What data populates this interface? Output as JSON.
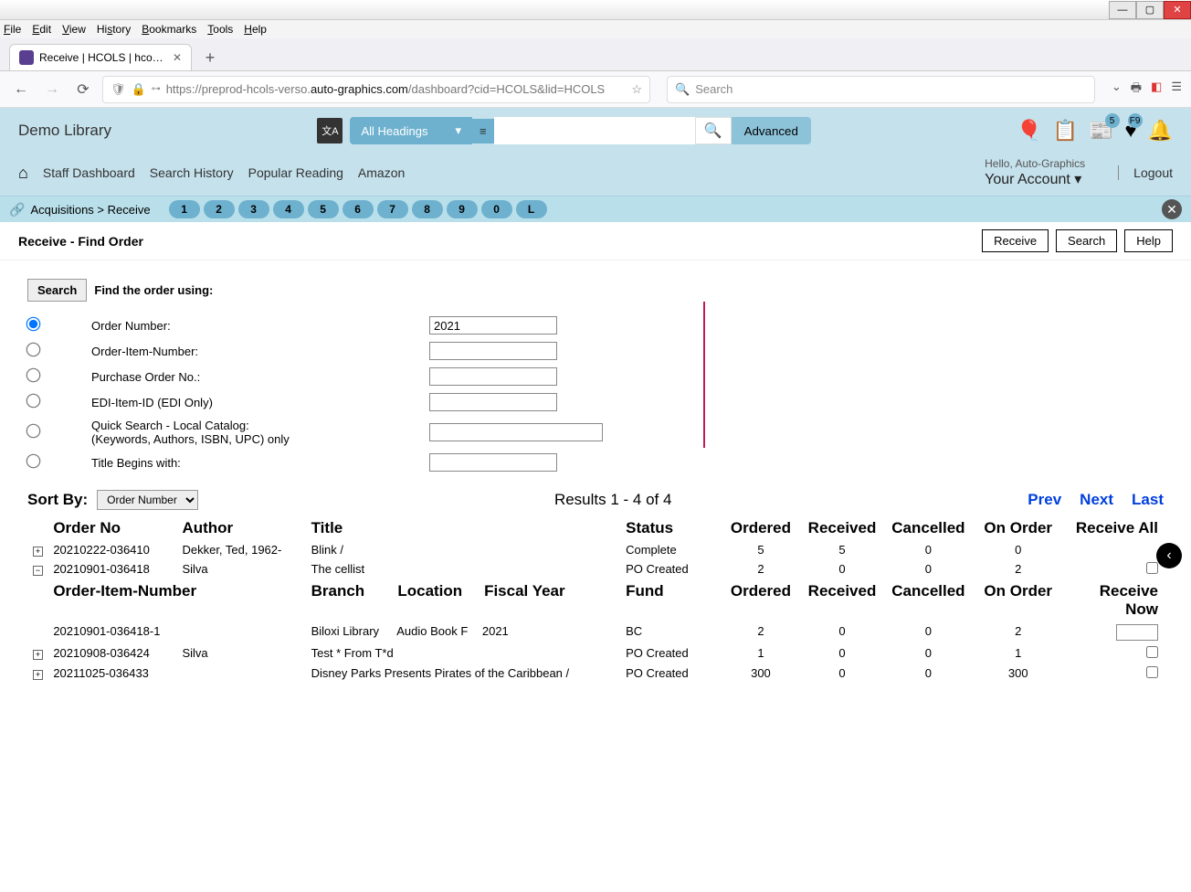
{
  "browser": {
    "menus": [
      "File",
      "Edit",
      "View",
      "History",
      "Bookmarks",
      "Tools",
      "Help"
    ],
    "tab_title": "Receive | HCOLS | hcols | Auto-",
    "url_prefix": "https://preprod-hcols-verso.",
    "url_domain": "auto-graphics.com",
    "url_path": "/dashboard?cid=HCOLS&lid=HCOLS",
    "search_placeholder": "Search"
  },
  "header": {
    "library_name": "Demo Library",
    "headings_label": "All Headings",
    "advanced_label": "Advanced",
    "news_badge": "5",
    "fav_badge": "F9",
    "hello_text": "Hello, Auto-Graphics",
    "account_text": "Your Account",
    "logout_text": "Logout",
    "nav_items": [
      "Staff Dashboard",
      "Search History",
      "Popular Reading",
      "Amazon"
    ]
  },
  "crumbs": {
    "path": "Acquisitions > Receive",
    "pills": [
      "1",
      "2",
      "3",
      "4",
      "5",
      "6",
      "7",
      "8",
      "9",
      "0",
      "L"
    ]
  },
  "page": {
    "title": "Receive - Find Order",
    "actions": {
      "receive": "Receive",
      "search": "Search",
      "help": "Help"
    },
    "search_btn": "Search",
    "instr": "Find the order using:",
    "radios": {
      "order_number": "Order Number:",
      "order_item_number": "Order-Item-Number:",
      "po_number": "Purchase Order No.:",
      "edi_item": "EDI-Item-ID (EDI Only)",
      "quick_search_line1": "Quick Search - Local Catalog:",
      "quick_search_line2": "(Keywords, Authors, ISBN, UPC) only",
      "title_begins": "Title Begins with:"
    },
    "order_number_value": "2021"
  },
  "results": {
    "sort_label": "Sort By:",
    "sort_value": "Order Number",
    "count_text": "Results 1 - 4 of 4",
    "pager": {
      "prev": "Prev",
      "next": "Next",
      "last": "Last"
    },
    "main_headers": [
      "Order No",
      "Author",
      "Title",
      "Status",
      "Ordered",
      "Received",
      "Cancelled",
      "On Order",
      "Receive All"
    ],
    "rows": [
      {
        "order": "20210222-036410",
        "author": "Dekker, Ted, 1962-",
        "title": "Blink /",
        "status": "Complete",
        "ordered": "5",
        "received": "5",
        "cancelled": "0",
        "onorder": "0",
        "exp": "+"
      },
      {
        "order": "20210901-036418",
        "author": "Silva",
        "title": "The cellist",
        "status": "PO Created",
        "ordered": "2",
        "received": "0",
        "cancelled": "0",
        "onorder": "2",
        "exp": "−"
      }
    ],
    "detail_headers": [
      "Order-Item-Number",
      "Branch",
      "Location",
      "Fiscal Year",
      "Fund",
      "Ordered",
      "Received",
      "Cancelled",
      "On Order",
      "Receive Now"
    ],
    "detail_row": {
      "oin": "20210901-036418-1",
      "branch": "Biloxi Library",
      "location": "Audio Book F",
      "fy": "2021",
      "fund": "BC",
      "ordered": "2",
      "received": "0",
      "cancelled": "0",
      "onorder": "2"
    },
    "rows2": [
      {
        "order": "20210908-036424",
        "author": "Silva",
        "title": "Test * From T*d",
        "status": "PO Created",
        "ordered": "1",
        "received": "0",
        "cancelled": "0",
        "onorder": "1",
        "exp": "+"
      },
      {
        "order": "20211025-036433",
        "author": "",
        "title": "Disney Parks Presents Pirates of the Caribbean /",
        "status": "PO Created",
        "ordered": "300",
        "received": "0",
        "cancelled": "0",
        "onorder": "300",
        "exp": "+"
      }
    ]
  }
}
